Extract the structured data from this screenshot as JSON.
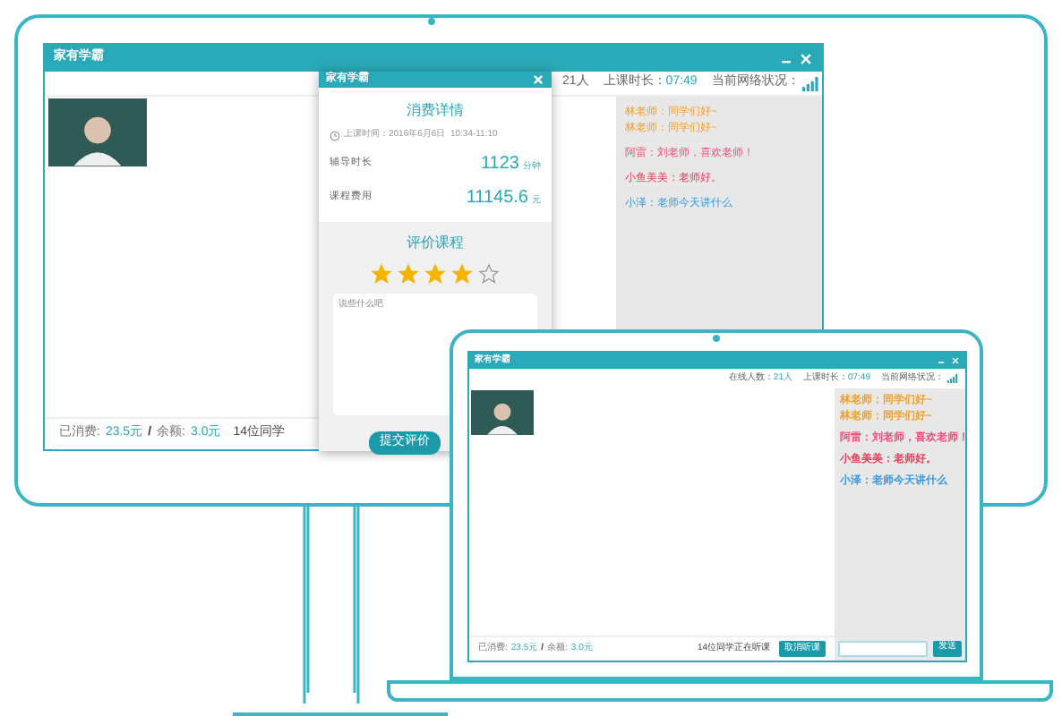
{
  "monitor": {
    "window": {
      "title": "家有学霸",
      "header": {
        "online_count": "21人",
        "duration_label": "上课时长：",
        "duration": "07:49",
        "network_label": "当前网络状况："
      },
      "chat": [
        [
          {
            "text": "林老师：同学们好~",
            "color": "#f0a030"
          },
          {
            "text": "林老师：同学们好~",
            "color": "#f0a030"
          }
        ],
        [
          {
            "text": "阿雷：刘老师，喜欢老师！",
            "color": "#f0507a"
          }
        ],
        [
          {
            "text": "小鱼美美：老师好。",
            "color": "#e8405a"
          }
        ],
        [
          {
            "text": "小泽：老师今天讲什么",
            "color": "#3a9ae0"
          }
        ]
      ],
      "footer": {
        "spent_label": "已消费:",
        "spent": "23.5元",
        "separator": "/",
        "balance_label": "余额:",
        "balance": "3.0元",
        "students": "14位同学"
      }
    }
  },
  "popup": {
    "title": "家有学霸",
    "heading": "消费详情",
    "time": "上课时间：2016年6月6日  10:34-11:10",
    "rows": [
      {
        "label": "辅导时长",
        "value": "1123",
        "unit": "分钟"
      },
      {
        "label": "课程费用",
        "value": "11145.6",
        "unit": "元"
      }
    ],
    "rating_heading": "评价课程",
    "stars": 4,
    "placeholder": "说些什么吧",
    "submit": "提交评价"
  },
  "laptop": {
    "window": {
      "title": "家有学霸",
      "header": {
        "online_label": "在线人数：",
        "online_count": "21人",
        "duration_label": "上课时长：",
        "duration": "07:49",
        "network_label": "当前网络状况："
      },
      "chat": [
        [
          {
            "text": "林老师：同学们好~",
            "color": "#f0a030"
          },
          {
            "text": "林老师：同学们好~",
            "color": "#f0a030"
          }
        ],
        [
          {
            "text": "阿雷：刘老师，喜欢老师！",
            "color": "#f0507a"
          }
        ],
        [
          {
            "text": "小鱼美美：老师好。",
            "color": "#e8405a"
          }
        ],
        [
          {
            "text": "小泽：老师今天讲什么",
            "color": "#3a9ae0"
          }
        ]
      ],
      "footer": {
        "spent_label": "已消费:",
        "spent": "23.5元",
        "separator": "/",
        "balance_label": "余额:",
        "balance": "3.0元",
        "students": "14位同学正在听课",
        "action": "取消听课",
        "send": "发送"
      }
    }
  }
}
